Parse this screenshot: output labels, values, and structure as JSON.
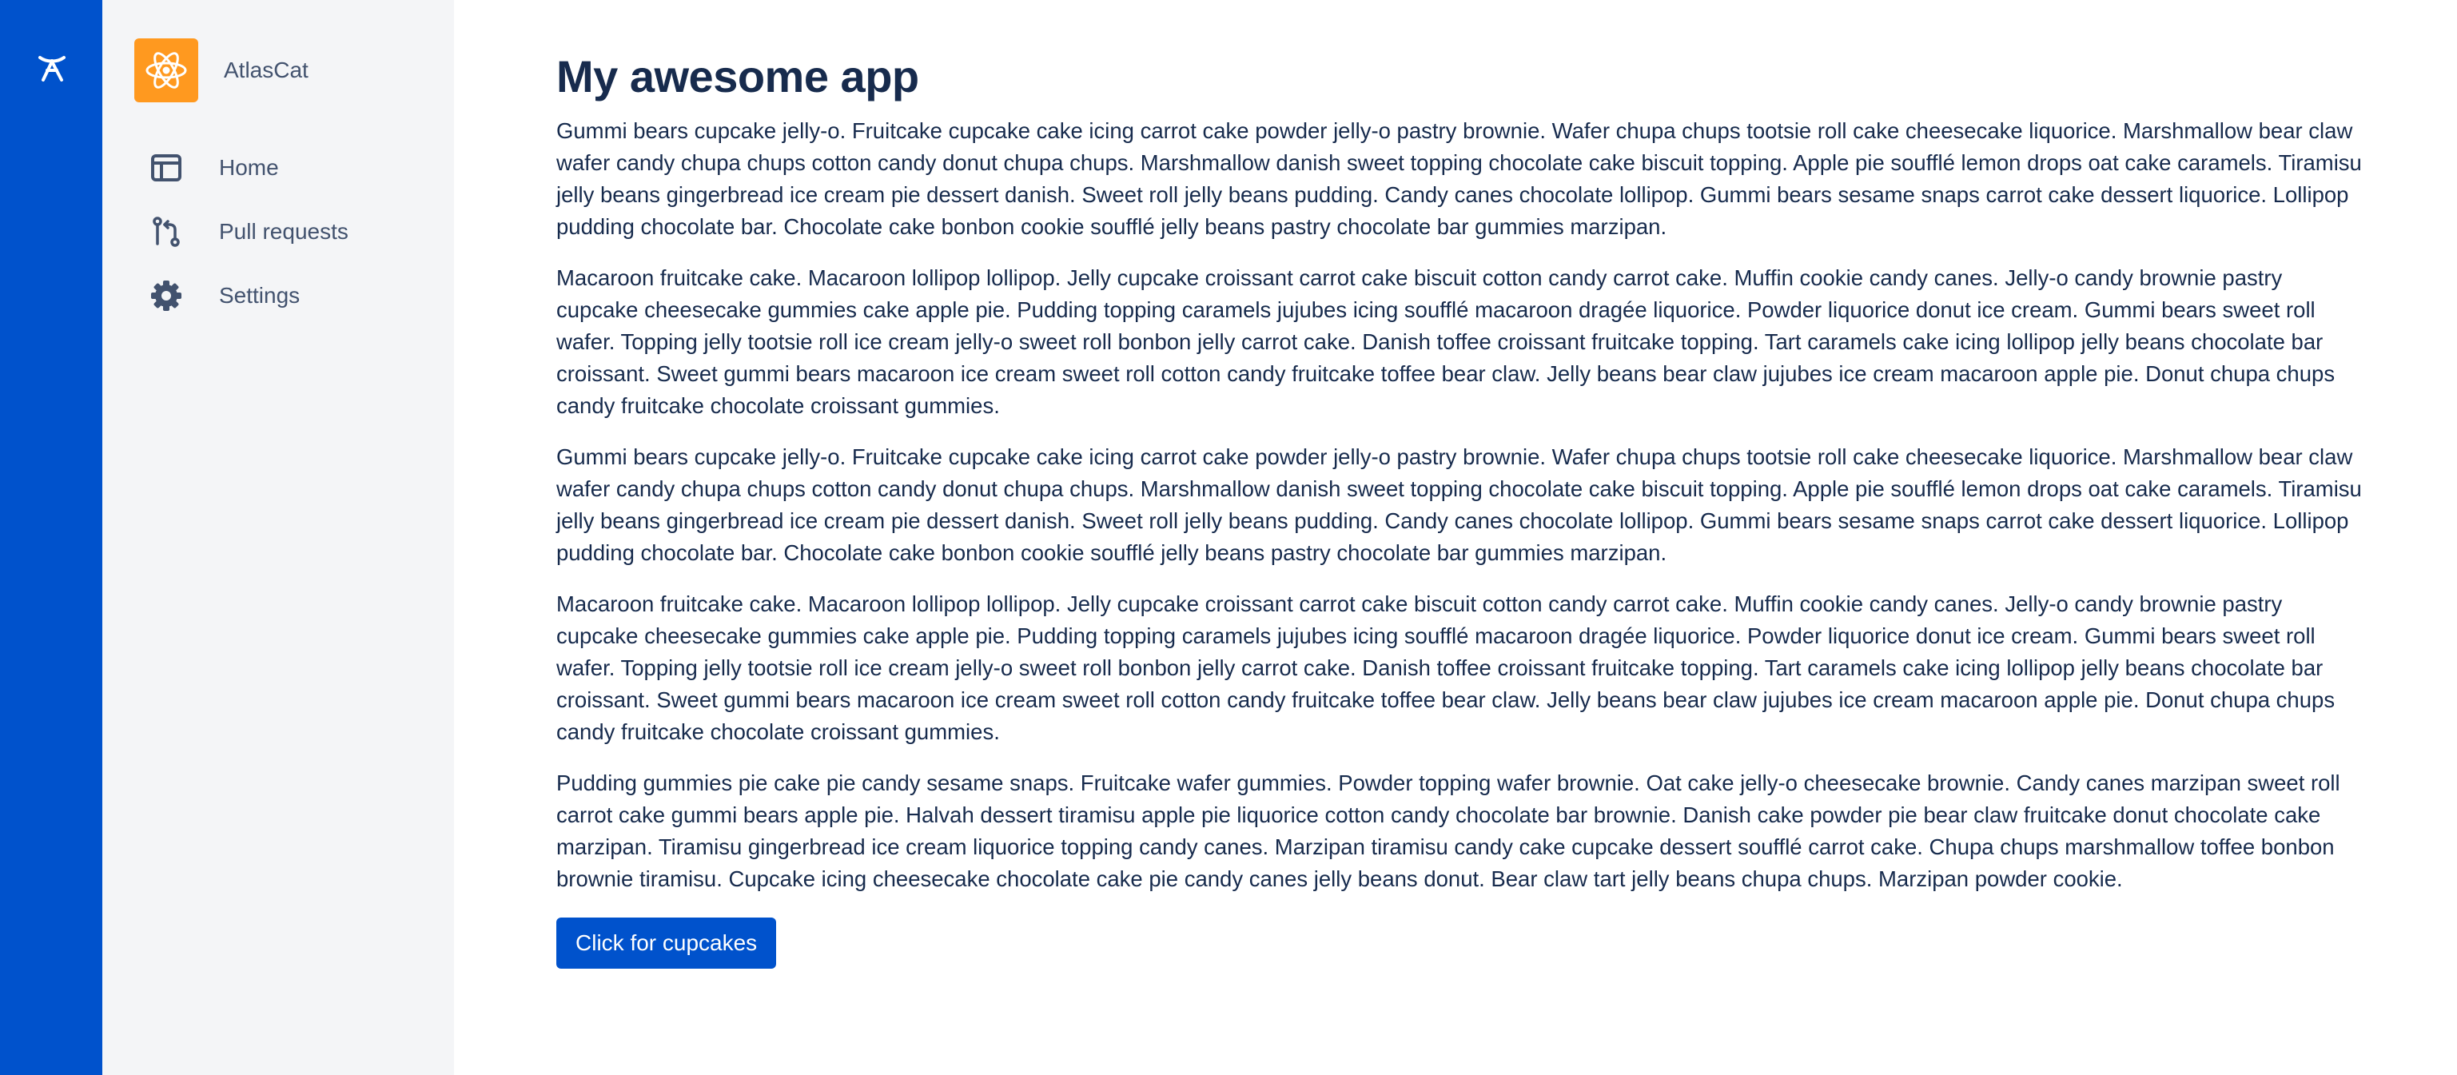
{
  "colors": {
    "global_nav": "#0052CC",
    "product_nav": "#F4F5F7",
    "brand_avatar": "#FF991F",
    "text_primary": "#172B4D",
    "text_secondary": "#42526E",
    "button": "#0052CC"
  },
  "global_nav": {
    "logo_icon": "atlassian-logo-icon"
  },
  "product": {
    "avatar_icon": "react-atom-icon",
    "name": "AtlasCat"
  },
  "nav": {
    "items": [
      {
        "icon": "dashboard-icon",
        "label": "Home"
      },
      {
        "icon": "pull-request-icon",
        "label": "Pull requests"
      },
      {
        "icon": "gear-icon",
        "label": "Settings"
      }
    ]
  },
  "main": {
    "title": "My awesome app",
    "paragraphs": [
      "Gummi bears cupcake jelly-o. Fruitcake cupcake cake icing carrot cake powder jelly-o pastry brownie. Wafer chupa chups tootsie roll cake cheesecake liquorice. Marshmallow bear claw wafer candy chupa chups cotton candy donut chupa chups. Marshmallow danish sweet topping chocolate cake biscuit topping. Apple pie soufflé lemon drops oat cake caramels. Tiramisu jelly beans gingerbread ice cream pie dessert danish. Sweet roll jelly beans pudding. Candy canes chocolate lollipop. Gummi bears sesame snaps carrot cake dessert liquorice. Lollipop pudding chocolate bar. Chocolate cake bonbon cookie soufflé jelly beans pastry chocolate bar gummies marzipan.",
      "Macaroon fruitcake cake. Macaroon lollipop lollipop. Jelly cupcake croissant carrot cake biscuit cotton candy carrot cake. Muffin cookie candy canes. Jelly-o candy brownie pastry cupcake cheesecake gummies cake apple pie. Pudding topping caramels jujubes icing soufflé macaroon dragée liquorice. Powder liquorice donut ice cream. Gummi bears sweet roll wafer. Topping jelly tootsie roll ice cream jelly-o sweet roll bonbon jelly carrot cake. Danish toffee croissant fruitcake topping. Tart caramels cake icing lollipop jelly beans chocolate bar croissant. Sweet gummi bears macaroon ice cream sweet roll cotton candy fruitcake toffee bear claw. Jelly beans bear claw jujubes ice cream macaroon apple pie. Donut chupa chups candy fruitcake chocolate croissant gummies.",
      "Gummi bears cupcake jelly-o. Fruitcake cupcake cake icing carrot cake powder jelly-o pastry brownie. Wafer chupa chups tootsie roll cake cheesecake liquorice. Marshmallow bear claw wafer candy chupa chups cotton candy donut chupa chups. Marshmallow danish sweet topping chocolate cake biscuit topping. Apple pie soufflé lemon drops oat cake caramels. Tiramisu jelly beans gingerbread ice cream pie dessert danish. Sweet roll jelly beans pudding. Candy canes chocolate lollipop. Gummi bears sesame snaps carrot cake dessert liquorice. Lollipop pudding chocolate bar. Chocolate cake bonbon cookie soufflé jelly beans pastry chocolate bar gummies marzipan.",
      "Macaroon fruitcake cake. Macaroon lollipop lollipop. Jelly cupcake croissant carrot cake biscuit cotton candy carrot cake. Muffin cookie candy canes. Jelly-o candy brownie pastry cupcake cheesecake gummies cake apple pie. Pudding topping caramels jujubes icing soufflé macaroon dragée liquorice. Powder liquorice donut ice cream. Gummi bears sweet roll wafer. Topping jelly tootsie roll ice cream jelly-o sweet roll bonbon jelly carrot cake. Danish toffee croissant fruitcake topping. Tart caramels cake icing lollipop jelly beans chocolate bar croissant. Sweet gummi bears macaroon ice cream sweet roll cotton candy fruitcake toffee bear claw. Jelly beans bear claw jujubes ice cream macaroon apple pie. Donut chupa chups candy fruitcake chocolate croissant gummies.",
      "Pudding gummies pie cake pie candy sesame snaps. Fruitcake wafer gummies. Powder topping wafer brownie. Oat cake jelly-o cheesecake brownie. Candy canes marzipan sweet roll carrot cake gummi bears apple pie. Halvah dessert tiramisu apple pie liquorice cotton candy chocolate bar brownie. Danish cake powder pie bear claw fruitcake donut chocolate cake marzipan. Tiramisu gingerbread ice cream liquorice topping candy canes. Marzipan tiramisu candy cake cupcake dessert soufflé carrot cake. Chupa chups marshmallow toffee bonbon brownie tiramisu. Cupcake icing cheesecake chocolate cake pie candy canes jelly beans donut. Bear claw tart jelly beans chupa chups. Marzipan powder cookie."
    ],
    "button_label": "Click for cupcakes"
  }
}
